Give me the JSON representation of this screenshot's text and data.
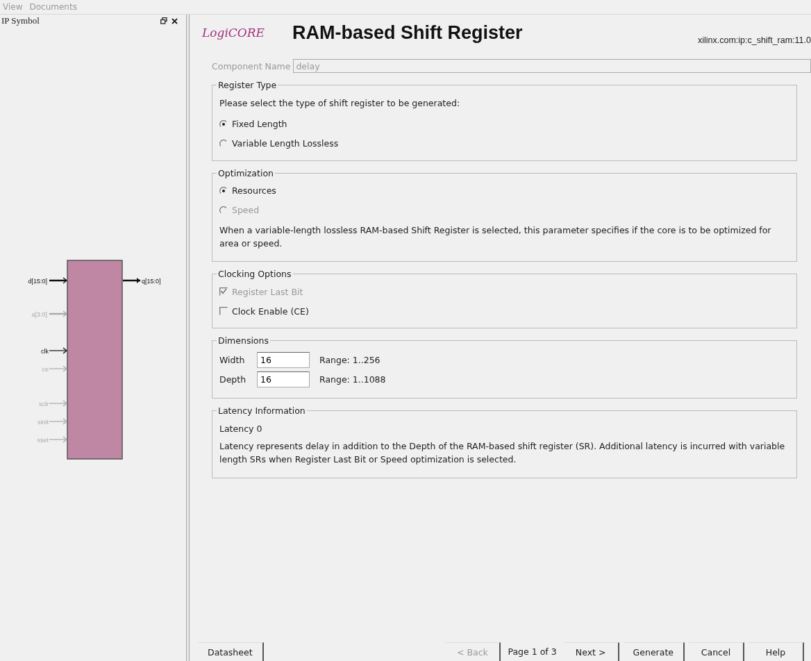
{
  "menu": [
    {
      "label": "View",
      "disabled": true
    },
    {
      "label": "Documents",
      "disabled": true
    }
  ],
  "symbol_panel": {
    "title": "IP Symbol",
    "inputs": [
      {
        "label": "d[15:0]",
        "enabled": true,
        "bus": true
      },
      {
        "label": "a[3:0]",
        "enabled": false,
        "bus": true
      },
      {
        "label": "clk",
        "enabled": true,
        "bus": false
      },
      {
        "label": "ce",
        "enabled": false,
        "bus": false
      },
      {
        "label": "sclr",
        "enabled": false,
        "bus": false
      },
      {
        "label": "sinit",
        "enabled": false,
        "bus": false
      },
      {
        "label": "sset",
        "enabled": false,
        "bus": false
      }
    ],
    "outputs": [
      {
        "label": "q[15:0]",
        "enabled": true,
        "bus": true
      }
    ]
  },
  "header": {
    "logo": "LogiCORE",
    "title": "RAM-based Shift Register",
    "core_id": "xilinx.com:ip:c_shift_ram:11.0"
  },
  "component_name": {
    "label": "Component Name",
    "value": "delay",
    "disabled": true
  },
  "groups": [
    {
      "title": "Register Type",
      "items": [
        {
          "kind": "text",
          "text": "Please select the type of shift register to be generated:"
        },
        {
          "kind": "radio",
          "label": "Fixed Length",
          "selected": true,
          "disabled": false
        },
        {
          "kind": "radio",
          "label": "Variable Length Lossless",
          "selected": false,
          "disabled": false
        }
      ]
    },
    {
      "title": "Optimization",
      "items": [
        {
          "kind": "radio",
          "label": "Resources",
          "selected": true,
          "disabled": false
        },
        {
          "kind": "radio",
          "label": "Speed",
          "selected": false,
          "disabled": true
        },
        {
          "kind": "text",
          "text": "When a variable-length lossless RAM-based Shift Register is selected, this parameter specifies if the core is to be optimized for area or speed."
        }
      ]
    },
    {
      "title": "Clocking Options",
      "items": [
        {
          "kind": "checkbox",
          "label": "Register Last Bit",
          "checked": true,
          "disabled": true
        },
        {
          "kind": "checkbox",
          "label": "Clock Enable (CE)",
          "checked": false,
          "disabled": false
        }
      ]
    },
    {
      "title": "Dimensions",
      "items": [
        {
          "kind": "field",
          "label": "Width",
          "value": "16",
          "range": "Range: 1..256"
        },
        {
          "kind": "field",
          "label": "Depth",
          "value": "16",
          "range": "Range: 1..1088"
        }
      ]
    },
    {
      "title": "Latency Information",
      "items": [
        {
          "kind": "text",
          "text": "Latency 0"
        },
        {
          "kind": "text",
          "text": "Latency represents delay in addition to the Depth of the RAM-based shift register (SR).  Additional latency is incurred with variable length SRs when Register Last Bit or Speed optimization is selected."
        }
      ]
    }
  ],
  "footer": {
    "datasheet": "Datasheet",
    "back": {
      "label": "< Back",
      "disabled": true
    },
    "page": "Page 1 of 3",
    "buttons": [
      "Next >",
      "Generate",
      "Cancel",
      "Help"
    ]
  }
}
